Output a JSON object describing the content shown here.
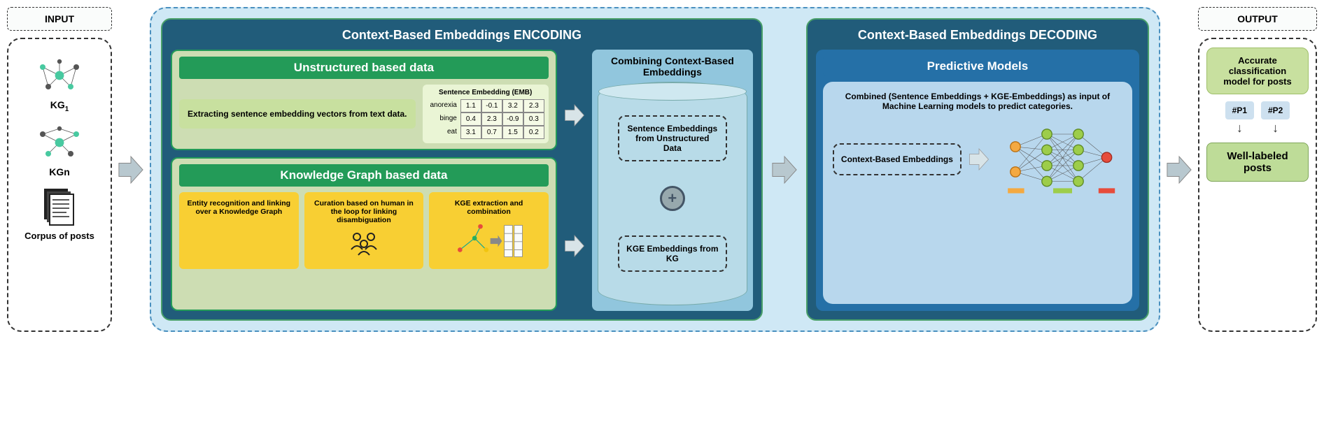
{
  "input": {
    "title": "INPUT",
    "kg1": "KG",
    "kg1_sub": "1",
    "kgn": "KGn",
    "corpus": "Corpus of posts"
  },
  "encoding": {
    "title": "Context-Based Embeddings ENCODING",
    "unstructured": {
      "title": "Unstructured based data",
      "extract": "Extracting sentence embedding vectors from text data.",
      "emb_title": "Sentence Embedding (EMB)",
      "rows": [
        "anorexia",
        "binge",
        "eat"
      ],
      "values": [
        [
          "1.1",
          "-0.1",
          "3.2",
          "2.3"
        ],
        [
          "0.4",
          "2.3",
          "-0.9",
          "0.3"
        ],
        [
          "3.1",
          "0.7",
          "1.5",
          "0.2"
        ]
      ]
    },
    "kgdata": {
      "title": "Knowledge Graph based data",
      "entity": "Entity recognition and linking over a Knowledge Graph",
      "curation": "Curation based on human in the loop for linking disambiguation",
      "kge": "KGE extraction and combination"
    },
    "combining": {
      "title": "Combining Context-Based Embeddings",
      "sentence": "Sentence Embeddings from Unstructured Data",
      "kge": "KGE Embeddings from KG"
    }
  },
  "decoding": {
    "title": "Context-Based Embeddings DECODING",
    "predictive_title": "Predictive Models",
    "desc": "Combined (Sentence Embeddings + KGE-Embeddings) as input of Machine Learning models to predict categories.",
    "input_box": "Context-Based Embeddings"
  },
  "output": {
    "title": "OUTPUT",
    "accurate": "Accurate classification model for posts",
    "p1": "#P1",
    "p2": "#P2",
    "well": "Well-labeled posts"
  }
}
